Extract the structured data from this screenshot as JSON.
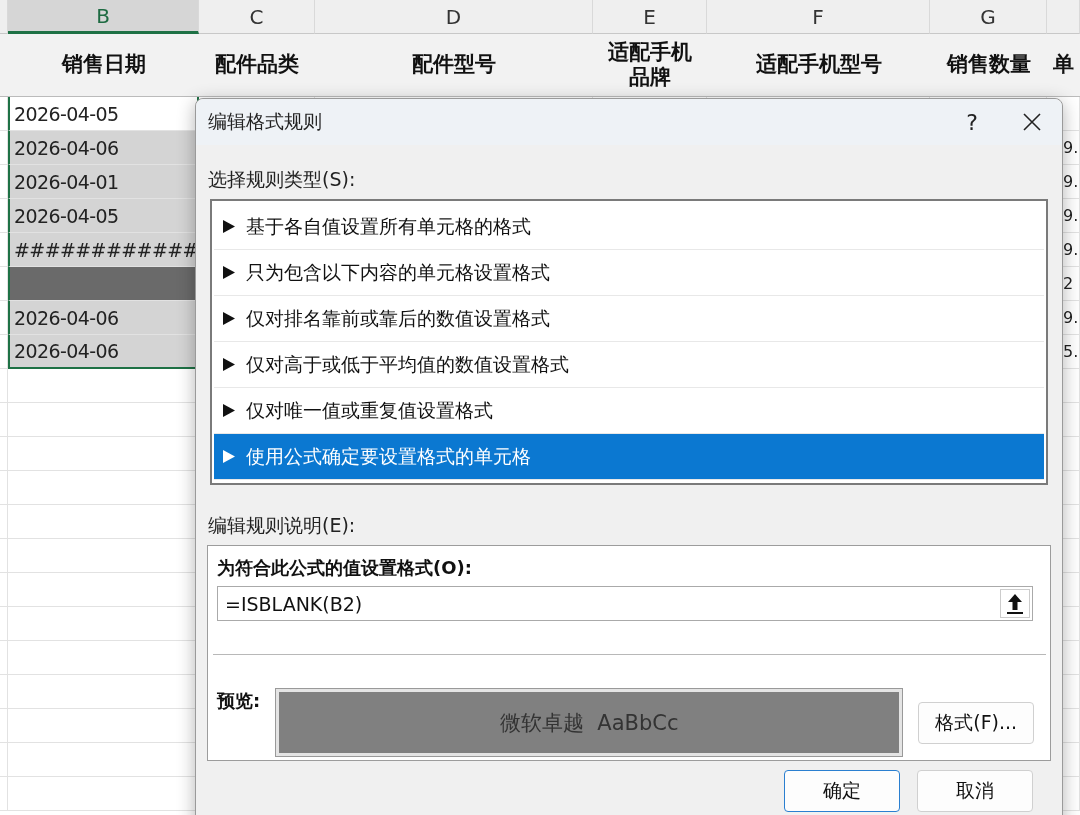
{
  "sheet": {
    "columns": [
      {
        "selected": false
      },
      {
        "letter": "B",
        "selected": true
      },
      {
        "letter": "C",
        "selected": false
      },
      {
        "letter": "D",
        "selected": false
      },
      {
        "letter": "E",
        "selected": false
      },
      {
        "letter": "F",
        "selected": false
      },
      {
        "letter": "G",
        "selected": false
      },
      {
        "selected": false
      }
    ],
    "headers": [
      "销售日期",
      "配件品类",
      "配件型号",
      "适配手机品牌",
      "适配手机型号",
      "销售数量",
      "单"
    ],
    "rows": [
      {
        "date": "2026-04-05",
        "color": "#ffffff"
      },
      {
        "date": "2026-04-06",
        "color": "#d4d4d4",
        "column_h": "9."
      },
      {
        "date": "2026-04-01",
        "color": "#d4d4d4",
        "column_h": "9."
      },
      {
        "date": "2026-04-05",
        "color": "#d4d4d4",
        "column_h": "9."
      },
      {
        "date": "############",
        "color": "#d4d4d4",
        "column_h": "9."
      },
      {
        "color": "#6a6a6a",
        "column_h": "2"
      },
      {
        "date": "2026-04-06",
        "color": "#d4d4d4",
        "column_h": "9."
      },
      {
        "date": "2026-04-06",
        "color": "#d4d4d4",
        "column_h": "5."
      }
    ]
  },
  "dialog": {
    "title": "编辑格式规则",
    "help": "?",
    "rule_type_label": "选择规则类型(S):",
    "rule_types": [
      {
        "label": "基于各自值设置所有单元格的格式",
        "selected": false
      },
      {
        "label": "只为包含以下内容的单元格设置格式",
        "selected": false
      },
      {
        "label": "仅对排名靠前或靠后的数值设置格式",
        "selected": false
      },
      {
        "label": "仅对高于或低于平均值的数值设置格式",
        "selected": false
      },
      {
        "label": "仅对唯一值或重复值设置格式",
        "selected": false
      },
      {
        "label": "使用公式确定要设置格式的单元格",
        "selected": true
      }
    ],
    "description_label": "编辑规则说明(E):",
    "formula_label": "为符合此公式的值设置格式(O):",
    "formula": "=ISBLANK(B2)",
    "preview_label": "预览:",
    "preview_text": "微软卓越  AaBbCc",
    "format_button": "格式(F)...",
    "ok": "确定",
    "cancel": "取消"
  }
}
